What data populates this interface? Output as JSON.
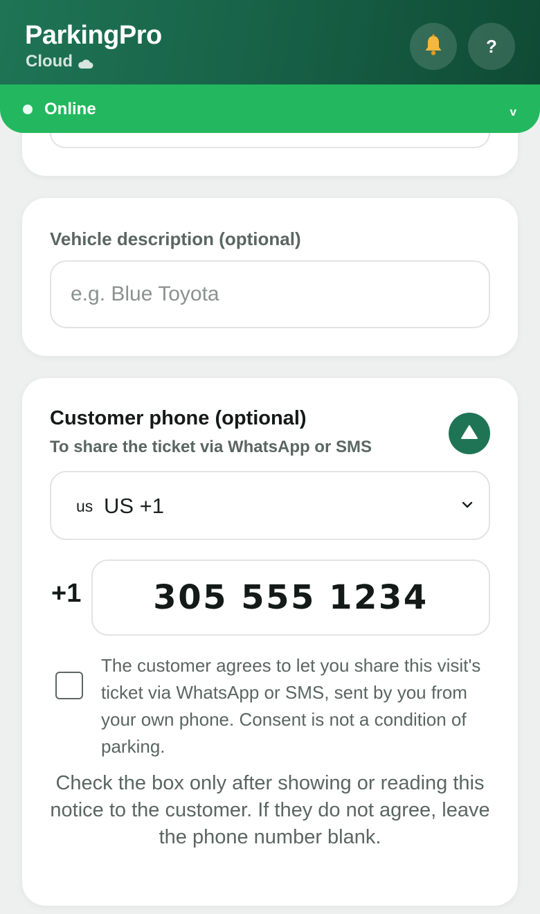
{
  "header": {
    "app_name": "ParkingPro",
    "app_tier": "Cloud",
    "tier_icon": "cloud-icon",
    "notification_icon": "bell-icon",
    "help_label": "?",
    "brand_color": "#1f7456"
  },
  "status_bar": {
    "status_text": "Online",
    "expand_glyph": "v",
    "status_color": "#23b85f"
  },
  "vehicle_card": {
    "label": "Vehicle description (optional)",
    "placeholder": "e.g. Blue Toyota",
    "value": ""
  },
  "phone_card": {
    "title": "Customer phone (optional)",
    "subtitle": "To share the ticket via WhatsApp or SMS",
    "collapse_icon": "triangle-up-icon",
    "country_select": {
      "flag": "us",
      "selected": "US +1"
    },
    "dial_prefix": "+1",
    "phone_number": "305 555 1234",
    "consent_checked": false,
    "consent_text": "The customer agrees to let you share this visit's ticket via WhatsApp or SMS, sent by you from your own phone. Consent is not a condition of parking.",
    "notice_text": "Check the box only after showing or reading this notice to the customer. If they do not agree, leave the phone number blank."
  }
}
